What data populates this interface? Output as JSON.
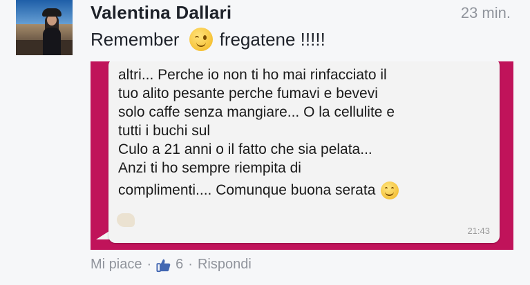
{
  "post": {
    "author": "Valentina Dallari",
    "time": "23 min.",
    "text_before": "Remember",
    "text_after": "fregatene !!!!!"
  },
  "message": {
    "lines": [
      "altri... Perche io non ti ho mai rinfacciato il",
      "tuo alito pesante perche fumavi e bevevi",
      "solo caffe senza mangiare... O la cellulite e",
      "tutti i buchi sul",
      "Culo a 21 anni o il fatto che sia pelata...",
      "Anzi ti ho sempre riempita di"
    ],
    "last_line": "complimenti.... Comunque buona serata",
    "time": "21:43"
  },
  "actions": {
    "like_label": "Mi piace",
    "like_count": "6",
    "reply_label": "Rispondi"
  },
  "colors": {
    "photo_background": "#c0135a",
    "bubble": "#f3f3f3",
    "meta_text": "#90949c"
  },
  "icons": {
    "wink": "wink-emoji-icon",
    "smile": "smile-emoji-icon",
    "like": "thumbs-up-icon"
  }
}
